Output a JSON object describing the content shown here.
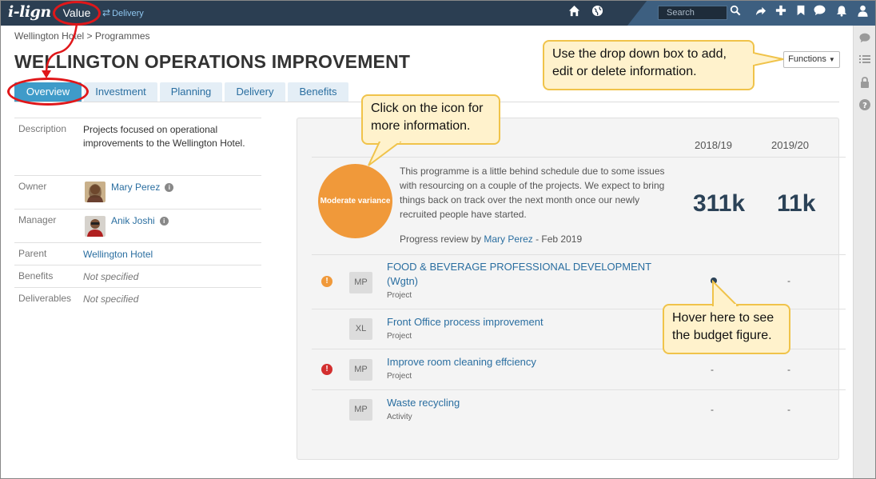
{
  "app": {
    "logo": "i-lign",
    "nav_value": "Value",
    "nav_delivery": "Delivery",
    "search_placeholder": "Search"
  },
  "breadcrumb": "Wellington Hotel > Programmes",
  "page_title": "WELLINGTON OPERATIONS IMPROVEMENT",
  "functions_label": "Functions",
  "tabs": [
    {
      "label": "Overview",
      "active": true
    },
    {
      "label": "Investment"
    },
    {
      "label": "Planning"
    },
    {
      "label": "Delivery"
    },
    {
      "label": "Benefits"
    }
  ],
  "info": {
    "description_label": "Description",
    "description_value": "Projects focused on operational improvements to the Wellington Hotel.",
    "owner_label": "Owner",
    "owner_value": "Mary Perez",
    "manager_label": "Manager",
    "manager_value": "Anik Joshi",
    "parent_label": "Parent",
    "parent_value": "Wellington Hotel",
    "benefits_label": "Benefits",
    "benefits_value": "Not specified",
    "deliverables_label": "Deliverables",
    "deliverables_value": "Not specified"
  },
  "panel": {
    "col1": "2018/19",
    "col2": "2019/20",
    "status_label": "Moderate variance",
    "status_color": "#f0993a",
    "summary": "This programme is a little behind schedule due to some issues with resourcing on a couple of the projects. We expect to bring things back on track over the next month once our newly recruited people have started.",
    "review_prefix": "Progress review by",
    "review_person": "Mary Perez",
    "review_date": "- Feb 2019",
    "total_1": "311k",
    "total_2": "11k",
    "projects": [
      {
        "title": "FOOD & BEVERAGE PROFESSIONAL DEVELOPMENT (Wgtn)",
        "type": "Project",
        "size": "MP",
        "warn": "orange",
        "c1": "",
        "c2": "-"
      },
      {
        "title": "Front Office process improvement",
        "type": "Project",
        "size": "XL",
        "warn": "",
        "c1": "",
        "c2": ""
      },
      {
        "title": "Improve room cleaning effciency",
        "type": "Project",
        "size": "MP",
        "warn": "red",
        "c1": "-",
        "c2": "-"
      },
      {
        "title": "Waste recycling",
        "type": "Activity",
        "size": "MP",
        "warn": "",
        "c1": "-",
        "c2": "-"
      }
    ]
  },
  "callouts": {
    "functions": "Use the drop down box to add, edit or delete information.",
    "icon": "Click on the icon for more information.",
    "hover": "Hover here to see the budget figure."
  },
  "colors": {
    "topbar": "#2b3e52",
    "tab_active": "#3f9bc9",
    "callout_fill": "#fff2cc",
    "callout_border": "#f0c34a",
    "highlight_ring": "#e0171a"
  }
}
